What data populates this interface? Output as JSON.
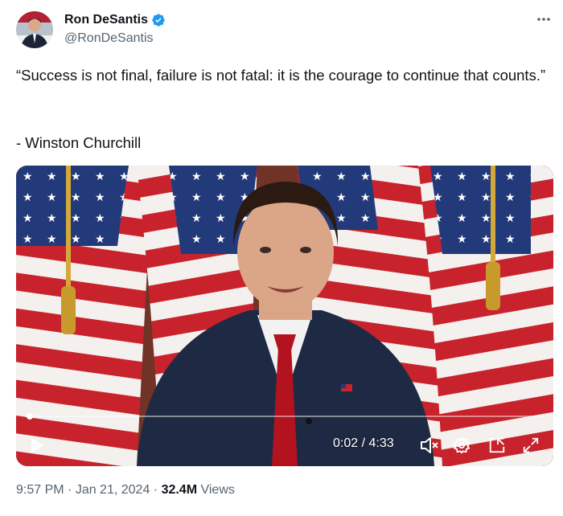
{
  "author": {
    "name": "Ron DeSantis",
    "handle": "@RonDeSantis",
    "verified": true
  },
  "tweet": {
    "text": "“Success is not final, failure is not fatal: it is the courage to continue that counts.”",
    "attribution": "- Winston Churchill"
  },
  "video": {
    "current_time": "0:02",
    "duration": "4:33",
    "progress_fraction": 0.007,
    "time_readout": "0:02 / 4:33"
  },
  "meta": {
    "time": "9:57 PM",
    "separator": " · ",
    "date": "Jan 21, 2024",
    "views_count": "32.4M",
    "views_label": " Views"
  },
  "colors": {
    "verified_blue": "#1d9bf0",
    "text_primary": "#0f1419",
    "text_secondary": "#536471"
  },
  "icons": [
    "verified-badge-icon",
    "more-options-icon",
    "play-icon",
    "mute-icon",
    "settings-icon",
    "picture-in-picture-icon",
    "fullscreen-icon"
  ]
}
